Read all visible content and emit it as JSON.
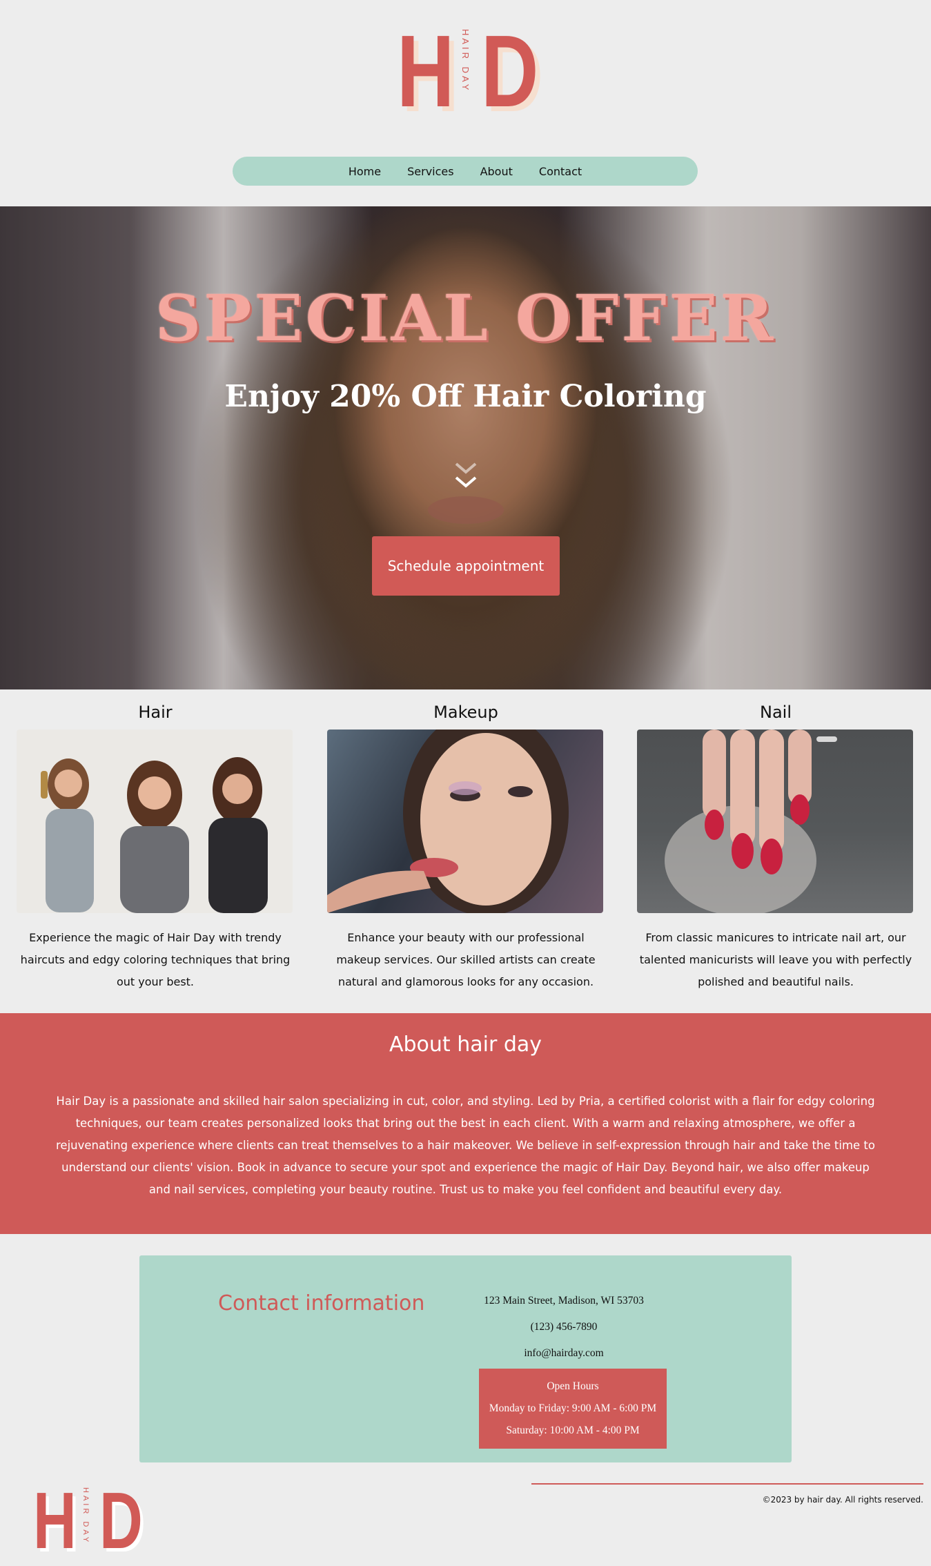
{
  "brand": {
    "mark_left": "H",
    "mark_right": "D",
    "tagline": "HAIR DAY"
  },
  "nav": [
    {
      "label": "Home"
    },
    {
      "label": "Services"
    },
    {
      "label": "About"
    },
    {
      "label": "Contact"
    }
  ],
  "hero": {
    "title": "SPECIAL OFFER",
    "subtitle": "Enjoy 20% Off Hair Coloring",
    "cta": "Schedule appointment"
  },
  "services": [
    {
      "title": "Hair",
      "description": "Experience the magic of Hair Day with trendy haircuts and edgy coloring techniques that bring out your best."
    },
    {
      "title": "Makeup",
      "description": "Enhance your beauty with our professional makeup services. Our skilled artists can create natural and glamorous looks for any occasion."
    },
    {
      "title": "Nail",
      "description": "From classic manicures to intricate nail art, our talented manicurists will leave you with perfectly polished and beautiful nails."
    }
  ],
  "about": {
    "title": "About hair day",
    "body": "Hair Day is a passionate and skilled hair salon specializing in cut, color, and styling. Led by Pria, a certified colorist with a flair for edgy coloring techniques, our team creates personalized looks that bring out the best in each client. With a warm and relaxing atmosphere, we offer a rejuvenating experience where clients can treat themselves to a hair makeover. We believe in self-expression through hair and take the time to understand our clients' vision. Book in advance to secure your spot and experience the magic of Hair Day. Beyond hair, we also offer makeup and nail services, completing your beauty routine. Trust us to make you feel confident and beautiful every day."
  },
  "contact": {
    "title": "Contact information",
    "address": "123 Main Street, Madison, WI 53703",
    "phone": "(123) 456-7890",
    "email": "info@hairday.com",
    "hours": {
      "title": "Open Hours",
      "weekdays": "Monday to Friday: 9:00 AM - 6:00 PM",
      "saturday": "Saturday: 10:00 AM - 4:00 PM"
    }
  },
  "footer": {
    "copyright": "©2023 by hair day. All rights reserved."
  },
  "colors": {
    "accent": "#cf5a58",
    "mint": "#aed7ca",
    "background": "#ededed",
    "offer": "#f4a79e"
  }
}
